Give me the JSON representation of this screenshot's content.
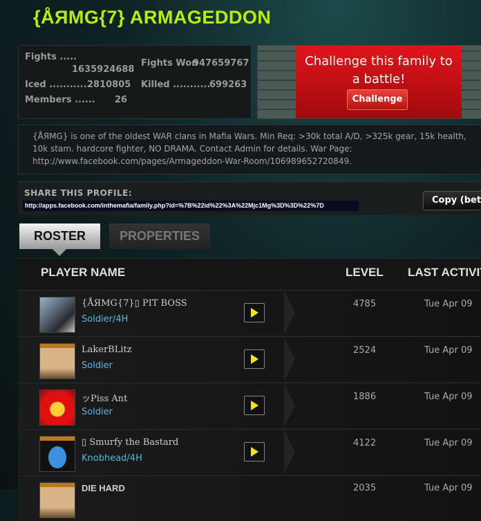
{
  "family_name": "{ÅЯMG{7} ARMAGEDDON",
  "stats": {
    "fights_label": "Fights .....",
    "fights_value": "1635924688",
    "fights_won_label": "Fights Won",
    "fights_won_value": "947659767",
    "iced_label": "Iced ............",
    "iced_value": "2810805",
    "killed_label": "Killed ...........",
    "killed_value": "699263",
    "members_label": "Members ......",
    "members_value": "26"
  },
  "challenge": {
    "text_line1": "Challenge this family to",
    "text_line2": "a battle!",
    "button_label": "Challenge"
  },
  "description": "{ÅЯMG} is one of the oldest WAR clans in Mafia Wars. Min Req: >30k total A/D, >325k gear, 15k health, 10k stam. hardcore fighter, NO DRAMA. Contact Admin for details. War Page: http://www.facebook.com/pages/Armageddon-War-Room/106989652720849.",
  "share": {
    "label": "SHARE THIS PROFILE:",
    "url": "http://apps.facebook.com/inthemafia/family.php?id=%7B%22id%22%3A%22Mjc1Mg%3D%3D%22%7D",
    "copy_label": "Copy (beta)"
  },
  "tabs": [
    {
      "label": "ROSTER",
      "active": true
    },
    {
      "label": "PROPERTIES",
      "active": false
    }
  ],
  "table": {
    "headers": {
      "player": "PLAYER NAME",
      "level": "LEVEL",
      "activity": "LAST ACTIVITY"
    },
    "rows": [
      {
        "name": "{ÅЯMG{7}▯ PIT BOSS",
        "rank": "Soldier/4H",
        "level": "4785",
        "last_activity": "Tue Apr 09"
      },
      {
        "name": "LakerBLitz",
        "rank": "Soldier",
        "level": "2524",
        "last_activity": "Tue Apr 09"
      },
      {
        "name": "ッPiss Ant",
        "rank": "Soldier",
        "level": "1886",
        "last_activity": "Tue Apr 09"
      },
      {
        "name": "▯ Smurfy the Bastard",
        "rank": "Knobhead/4H",
        "level": "4122",
        "last_activity": "Tue Apr 09"
      },
      {
        "name": "DIE HARD",
        "rank": "",
        "level": "2035",
        "last_activity": "Tue Apr 09"
      }
    ]
  },
  "colors": {
    "title": "#b8f000",
    "stat_value": "#5fc0e6",
    "challenge_red": "#e0151b",
    "play_arrow": "#f2e600"
  }
}
